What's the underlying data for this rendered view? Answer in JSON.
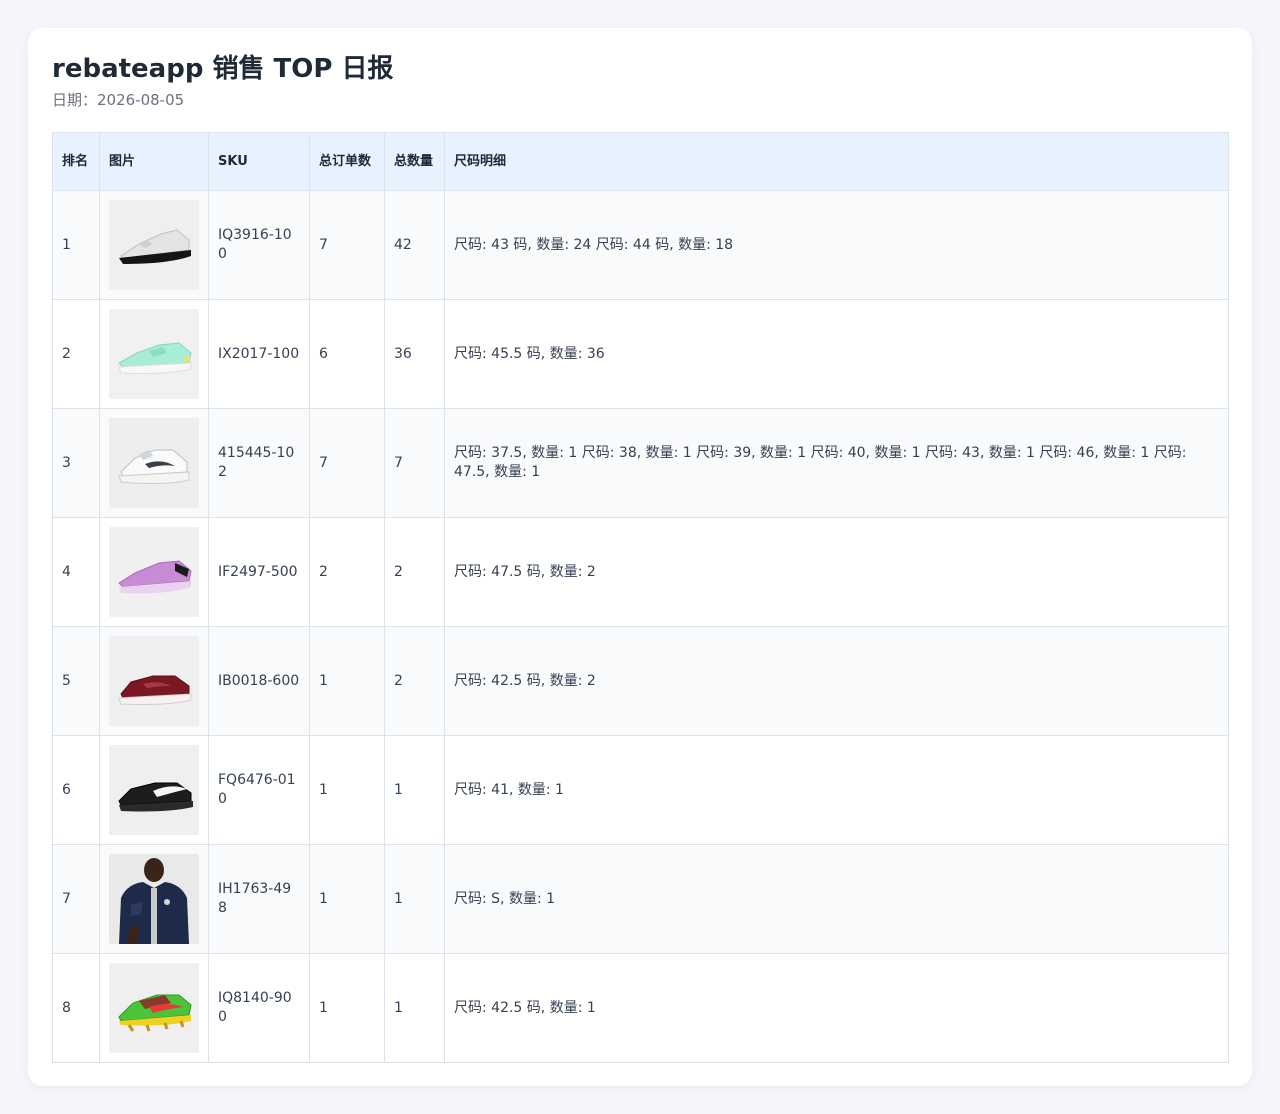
{
  "header": {
    "title": "rebateapp 销售 TOP 日报",
    "date": "日期：2026-08-05"
  },
  "table": {
    "columns": [
      "排名",
      "图片",
      "SKU",
      "总订单数",
      "总数量",
      "尺码明细"
    ],
    "rows": [
      {
        "rank": "1",
        "image_icon": "sneaker-white-black-image",
        "sku": "IQ3916-100",
        "orders": "7",
        "quantity": "42",
        "sizes": "尺码: 43 码, 数量: 24 尺码: 44 码, 数量: 18"
      },
      {
        "rank": "2",
        "image_icon": "sneaker-mint-image",
        "sku": "IX2017-100",
        "orders": "6",
        "quantity": "36",
        "sizes": "尺码: 45.5 码, 数量: 36"
      },
      {
        "rank": "3",
        "image_icon": "sneaker-white-chunky-image",
        "sku": "415445-102",
        "orders": "7",
        "quantity": "7",
        "sizes": "尺码: 37.5, 数量: 1 尺码: 38, 数量: 1 尺码: 39, 数量: 1 尺码: 40, 数量: 1 尺码: 43, 数量: 1 尺码: 46, 数量: 1 尺码: 47.5, 数量: 1"
      },
      {
        "rank": "4",
        "image_icon": "sneaker-purple-image",
        "sku": "IF2497-500",
        "orders": "2",
        "quantity": "2",
        "sizes": "尺码: 47.5 码, 数量: 2"
      },
      {
        "rank": "5",
        "image_icon": "sneaker-burgundy-image",
        "sku": "IB0018-600",
        "orders": "1",
        "quantity": "2",
        "sizes": "尺码: 42.5 码, 数量: 2"
      },
      {
        "rank": "6",
        "image_icon": "sneaker-black-image",
        "sku": "FQ6476-010",
        "orders": "1",
        "quantity": "1",
        "sizes": "尺码: 41, 数量: 1"
      },
      {
        "rank": "7",
        "image_icon": "jacket-navy-image",
        "sku": "IH1763-498",
        "orders": "1",
        "quantity": "1",
        "sizes": "尺码: S, 数量: 1"
      },
      {
        "rank": "8",
        "image_icon": "football-boot-green-image",
        "sku": "IQ8140-900",
        "orders": "1",
        "quantity": "1",
        "sizes": "尺码: 42.5 码, 数量: 1"
      }
    ]
  },
  "colors": {
    "header_bg": "#e8f1fe",
    "border": "#dde3ea",
    "stripe": "#f8fafc"
  }
}
